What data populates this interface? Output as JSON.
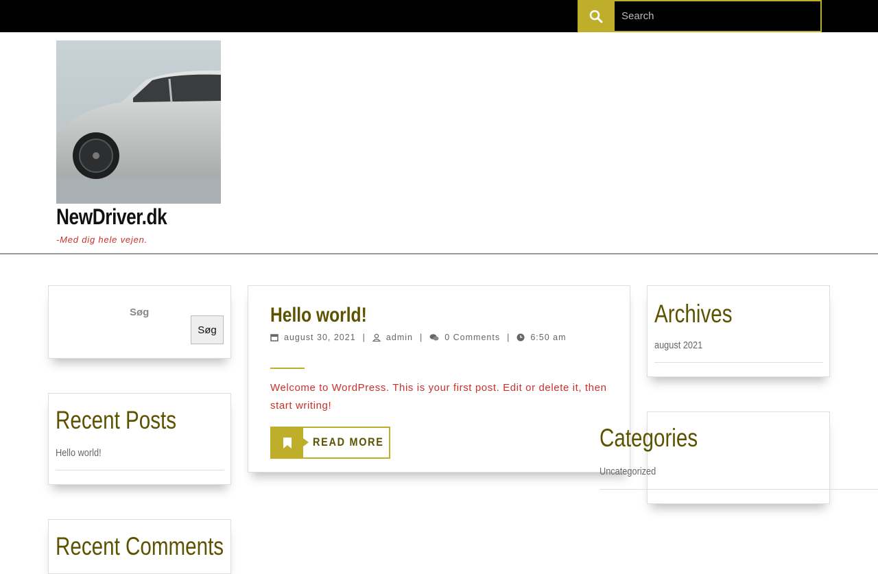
{
  "search": {
    "placeholder": "Search"
  },
  "site": {
    "title": "NewDriver.dk",
    "tagline": "-Med dig hele vejen."
  },
  "sidebar_left": {
    "search_label": "Søg",
    "search_button": "Søg",
    "recent_posts_title": "Recent Posts",
    "recent_posts": [
      "Hello world!"
    ],
    "recent_comments_title": "Recent Comments"
  },
  "post": {
    "title": "Hello world!",
    "date": "august 30, 2021",
    "author": "admin",
    "comments": "0 Comments",
    "time": "6:50 am",
    "excerpt": "Welcome to WordPress. This is your first post. Edit or delete it, then start writing!",
    "read_more": "READ MORE"
  },
  "sidebar_right": {
    "archives_title": "Archives",
    "archives": [
      "august 2021"
    ],
    "categories_title": "Categories",
    "categories": [
      "Uncategorized"
    ]
  },
  "colors": {
    "accent": "#bfae2a",
    "title": "#5c5200",
    "tagline": "#c9302c",
    "topbar": "#000000"
  }
}
